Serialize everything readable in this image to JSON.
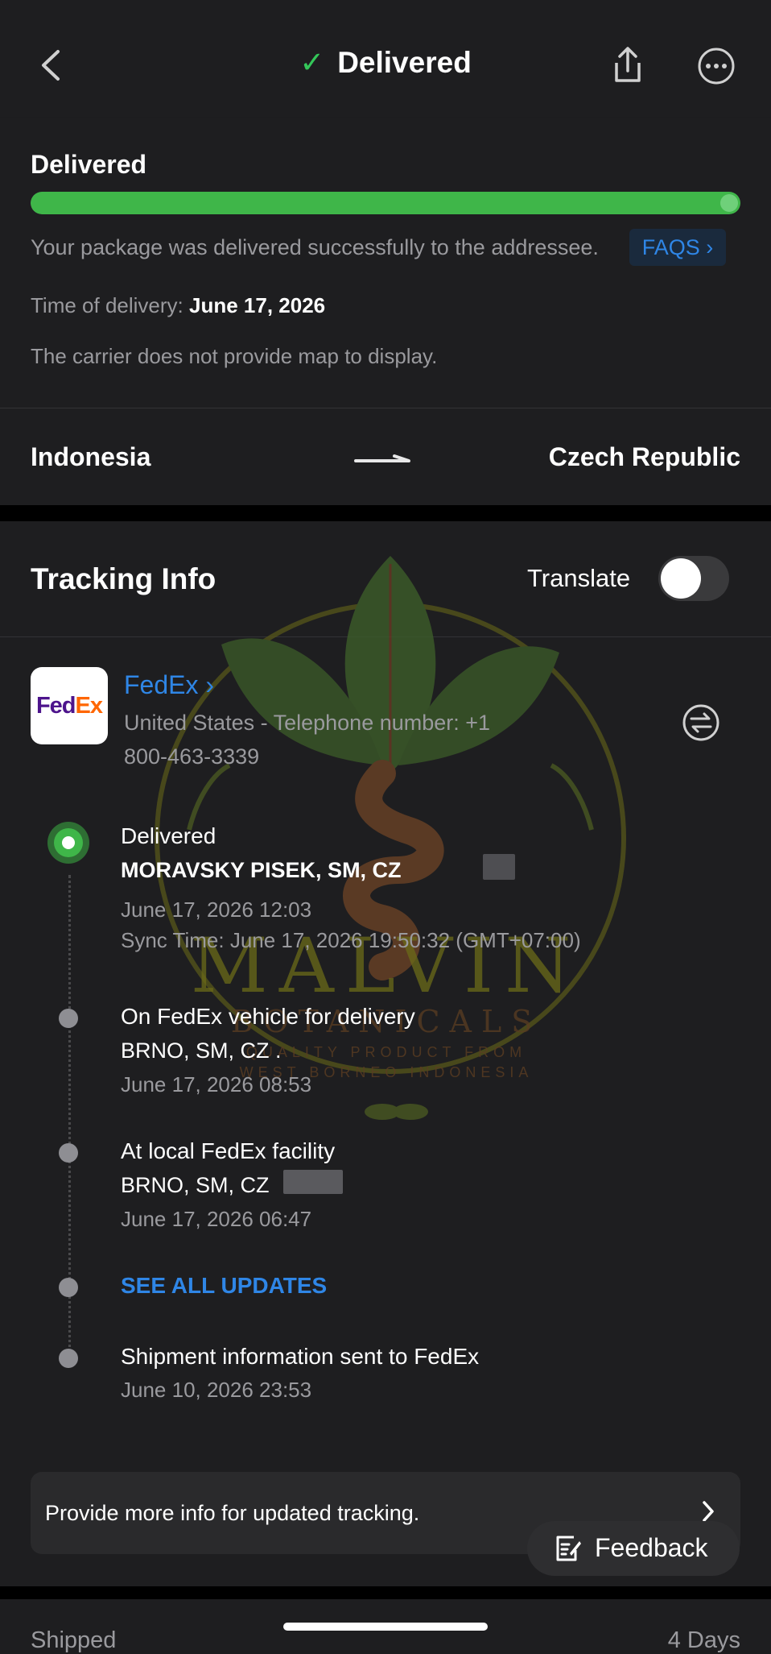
{
  "header": {
    "title": "Delivered"
  },
  "status": {
    "title": "Delivered",
    "progress": 1.0,
    "message": "Your package was delivered successfully to the addressee.",
    "faqs_label": "FAQS ›",
    "delivery_time_label": "Time of delivery:",
    "delivery_time_value": "June 17, 2026",
    "map_note": "The carrier does not provide map to display."
  },
  "route": {
    "origin": "Indonesia",
    "destination": "Czech Republic"
  },
  "tracking": {
    "title": "Tracking Info",
    "translate_label": "Translate",
    "translate_on": false,
    "carrier": {
      "logo_text_fed": "Fed",
      "logo_text_ex": "Ex",
      "name": "FedEx ›",
      "phone_line1": "United States - Telephone number: +1",
      "phone_line2": "800-463-3339"
    },
    "events": [
      {
        "title": "Delivered",
        "location": "MORAVSKY PISEK, SM, CZ",
        "time": "June 17, 2026 12:03",
        "sync": "Sync Time: June 17, 2026 19:50:32 (GMT+07:00)"
      },
      {
        "title": "On FedEx vehicle for delivery",
        "location": "BRNO, SM, CZ .",
        "time": "June 17, 2026 08:53"
      },
      {
        "title": "At local FedEx facility",
        "location": "BRNO, SM, CZ",
        "time": "June 17, 2026 06:47"
      },
      {
        "title": "SEE ALL UPDATES"
      },
      {
        "title": "Shipment information sent to FedEx",
        "time": "June 10, 2026 23:53"
      }
    ]
  },
  "more_info": {
    "label": "Provide more info for updated tracking."
  },
  "feedback": {
    "label": "Feedback"
  },
  "summary": {
    "shipped_label": "Shipped",
    "days_label": "4 Days"
  },
  "watermark": {
    "name": "MALVIN",
    "sub": "BOTANICALS",
    "line1": "QUALITY PRODUCT FROM",
    "line2": "WEST BORNEO INDONESIA"
  },
  "colors": {
    "accent_green": "#3fb649",
    "link_blue": "#2f86e6",
    "background": "#1c1c1e"
  }
}
